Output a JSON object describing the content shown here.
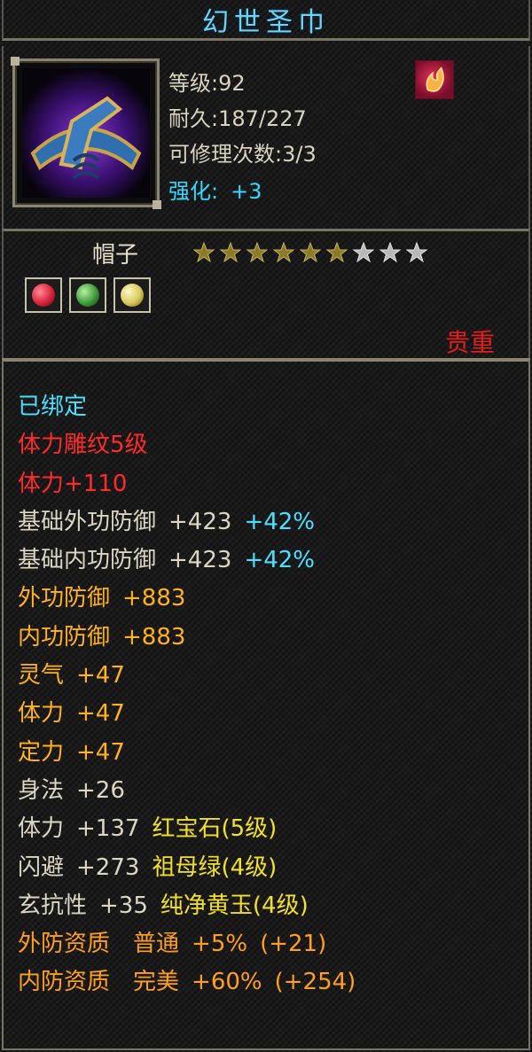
{
  "title": "幻世圣巾",
  "header": {
    "level": "等级:92",
    "durability": "耐久:187/227",
    "repair": "可修理次数:3/3",
    "enhance_label": "强化:",
    "enhance_value": "+3",
    "badge_icon": "flame-badge-icon"
  },
  "item_type": "帽子",
  "stars": {
    "total": 9,
    "filled": 6
  },
  "gems": [
    {
      "icon": "ruby-gem-icon",
      "color": "#d8233a"
    },
    {
      "icon": "emerald-gem-icon",
      "color": "#3f9a3a"
    },
    {
      "icon": "yellow-jade-gem-icon",
      "color": "#d8c85a"
    }
  ],
  "quality": "贵重",
  "attributes": {
    "bound": "已绑定",
    "engrave": "体力雕纹5级",
    "engrave_stat": "体力+110",
    "base_ext_def": {
      "label": "基础外功防御",
      "value": "+423",
      "pct": "+42%"
    },
    "base_int_def": {
      "label": "基础内功防御",
      "value": "+423",
      "pct": "+42%"
    },
    "ext_def": {
      "label": "外功防御",
      "value": "+883"
    },
    "int_def": {
      "label": "内功防御",
      "value": "+883"
    },
    "spirit": {
      "label": "灵气",
      "value": "+47"
    },
    "stamina": {
      "label": "体力",
      "value": "+47"
    },
    "focus": {
      "label": "定力",
      "value": "+47"
    },
    "agility": {
      "label": "身法",
      "value": "+26"
    },
    "gem1": {
      "label": "体力",
      "value": "+137",
      "gem": "红宝石(5级)"
    },
    "gem2": {
      "label": "闪避",
      "value": "+273",
      "gem": "祖母绿(4级)"
    },
    "gem3": {
      "label": "玄抗性",
      "value": "+35",
      "gem": "纯净黄玉(4级)"
    },
    "ext_quality": {
      "label": "外防资质",
      "grade": "普通",
      "value": "+5%",
      "bonus": "(+21)"
    },
    "int_quality": {
      "label": "内防资质",
      "grade": "完美",
      "value": "+60%",
      "bonus": "(+254)"
    }
  }
}
